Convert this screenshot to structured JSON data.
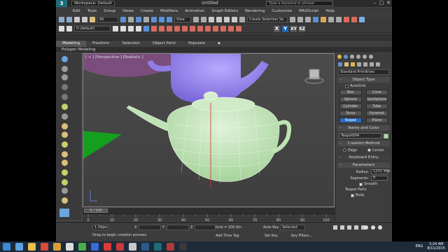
{
  "titlebar": {
    "workspace": "Workspace: Default",
    "title": "Untitled",
    "search_placeholder": "Type a keyword or phrase"
  },
  "menu": [
    "Edit",
    "Tools",
    "Group",
    "Views",
    "Create",
    "Modifiers",
    "Animation",
    "Graph Editors",
    "Rendering",
    "Customize",
    "MAXScript",
    "Help"
  ],
  "toolbar": {
    "selection_filter": "All",
    "layer": "0 (default)",
    "view_combo": "View",
    "named_sel": "Create Selection Se",
    "axis_x": "X",
    "axis_y": "Y",
    "axis_xy": "XY",
    "axis_xz": "XZ"
  },
  "ribbon": {
    "tabs": [
      "Modeling",
      "Freeform",
      "Selection",
      "Object Paint",
      "Populate"
    ],
    "sub_label": "Polygon Modeling"
  },
  "viewport": {
    "label": "[ + ] [Perspective ] [Realistic ]"
  },
  "command_panel": {
    "category": "Standard Primitives",
    "object_type_title": "Object Type",
    "autogrid": "AutoGrid",
    "buttons": [
      "Box",
      "Cone",
      "Sphere",
      "GeoSphere",
      "Cylinder",
      "Tube",
      "Torus",
      "Pyramid",
      "Teapot",
      "Plane"
    ],
    "name_color_title": "Name and Color",
    "object_name": "Teapot004",
    "creation_method_title": "Creation Method",
    "edge_label": "Edge",
    "center_label": "Center",
    "keyboard_entry_title": "Keyboard Entry",
    "parameters_title": "Parameters",
    "radius_label": "Radius:",
    "radius_value": "1231.369",
    "segments_label": "Segments:",
    "segments_value": "8",
    "smooth_label": "Smooth",
    "teapot_parts_label": "Teapot Parts",
    "body_label": "Body"
  },
  "timeline": {
    "frame_display": "0 / 100",
    "ticks": [
      "0",
      "10",
      "20",
      "30",
      "40",
      "50",
      "60",
      "70",
      "80",
      "90",
      "100"
    ]
  },
  "statusbar": {
    "selection": "1 Objec",
    "prompt": "Drag to begin creation process",
    "x_label": "X",
    "y_label": "Y",
    "z_label": "Z",
    "grid": "Grid = 100.0m",
    "add_time_tag": "Add Time Tag",
    "auto_key": "Auto Key",
    "selected": "Selected",
    "set_key": "Set Key",
    "key_filters": "Key Filters..."
  },
  "taskbar": {
    "language": "ENG",
    "time": "3:24 AM",
    "date": "8/11/2015"
  }
}
